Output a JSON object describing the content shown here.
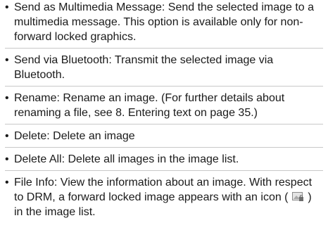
{
  "items": [
    {
      "text": "Send as Multimedia Message: Send the selected image to a multimedia message. This option is available only for non-forward locked graphics."
    },
    {
      "text": "Send via Bluetooth: Transmit the selected image via Bluetooth."
    },
    {
      "text": "Rename: Rename an image. (For further details about renaming a file, see 8. Entering text on page 35.)"
    },
    {
      "text": "Delete: Delete an image"
    },
    {
      "text": "Delete All: Delete all images in the image list."
    },
    {
      "text_before_icon": "File Info: View the information about an image. With respect to DRM, a forward locked image appears with an icon (",
      "icon": "locked-image-icon",
      "text_after_icon": ") in the image list."
    }
  ],
  "bullet": "•"
}
